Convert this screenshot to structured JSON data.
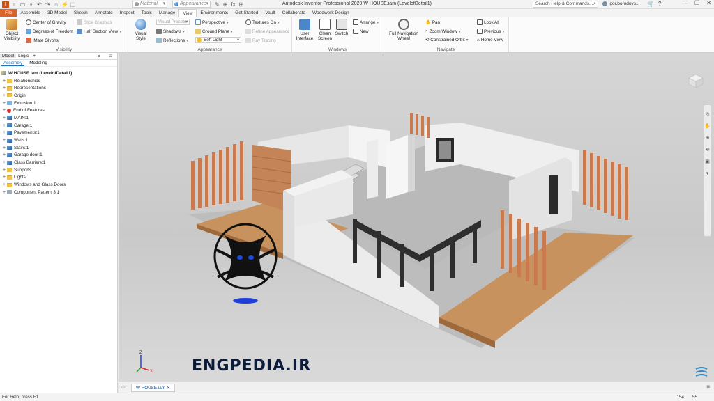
{
  "window": {
    "title": "Autodesk Inventor Professional 2020   W HOUSE.iam (LevelofDetail1)",
    "search_placeholder": "Search Help & Commands...",
    "user_name": "igor.borodovs..."
  },
  "quick_access": {
    "material": "Material",
    "appearance": "Appearance",
    "fx_label": "fx"
  },
  "tabs": [
    "File",
    "Assemble",
    "3D Model",
    "Sketch",
    "Annotate",
    "Inspect",
    "Tools",
    "Manage",
    "View",
    "Environments",
    "Get Started",
    "Vault",
    "Collaborate",
    "Woodwork Design"
  ],
  "active_tab": "View",
  "ribbon": {
    "visibility": {
      "title": "Visibility",
      "object_visibility": "Object Visibility",
      "center_of_gravity": "Center of Gravity",
      "degrees_of_freedom": "Degrees of Freedom",
      "imate_glyphs": "iMate Glyphs",
      "slice_graphics": "Slice Graphics",
      "half_section_view": "Half Section View"
    },
    "appearance": {
      "title": "Appearance",
      "visual_style": "Visual Style",
      "visual_presets": "Visual Presets",
      "shadows": "Shadows",
      "reflections": "Reflections",
      "perspective": "Perspective",
      "ground_plane": "Ground Plane",
      "soft_light": "Soft Light",
      "textures_on": "Textures On",
      "refine_appearance": "Refine Appearance",
      "ray_tracing": "Ray Tracing"
    },
    "windows": {
      "title": "Windows",
      "user_interface": "User Interface",
      "clean_screen": "Clean Screen",
      "switch": "Switch",
      "arrange": "Arrange",
      "new": "New"
    },
    "navigate": {
      "title": "Navigate",
      "full_navigation_wheel": "Full Navigation Wheel",
      "pan": "Pan",
      "zoom_window": "Zoom Window",
      "constrained_orbit": "Constrained Orbit",
      "look_at": "Look At",
      "previous": "Previous",
      "home_view": "Home View"
    }
  },
  "browser": {
    "tabs": [
      "Model",
      "Logic"
    ],
    "subtabs": [
      "Assembly",
      "Modeling"
    ],
    "root": "W HOUSE.iam (LevelofDetail1)",
    "items": [
      {
        "label": "Relationships",
        "icon": "folder"
      },
      {
        "label": "Representations",
        "icon": "folder"
      },
      {
        "label": "Origin",
        "icon": "folder"
      },
      {
        "label": "Extrusion 1",
        "icon": "feature"
      },
      {
        "label": "End of Features",
        "icon": "eof"
      },
      {
        "label": "MAIN:1",
        "icon": "part"
      },
      {
        "label": "Garage:1",
        "icon": "part"
      },
      {
        "label": "Pavements:1",
        "icon": "part"
      },
      {
        "label": "Walls:1",
        "icon": "part"
      },
      {
        "label": "Stairs:1",
        "icon": "part"
      },
      {
        "label": "Garage door:1",
        "icon": "part"
      },
      {
        "label": "Glass Barriers:1",
        "icon": "part"
      },
      {
        "label": "Supports",
        "icon": "folder"
      },
      {
        "label": "Lights",
        "icon": "folder"
      },
      {
        "label": "Windows and Glass Doors",
        "icon": "folder"
      },
      {
        "label": "Component Pattern 3:1",
        "icon": "pattern"
      }
    ]
  },
  "viewport": {
    "watermark": "ENGPEDIA.IR",
    "axis": {
      "z": "Z",
      "x": "X",
      "y": "Y"
    }
  },
  "document_tab": "W HOUSE.iam",
  "status": {
    "help_text": "For Help, press F1",
    "count1": "154",
    "count2": "55"
  },
  "colors": {
    "file_tab": "#d8632b",
    "wood": "#c98455",
    "wall": "#efefef",
    "watermark": "#0b1c3a"
  }
}
